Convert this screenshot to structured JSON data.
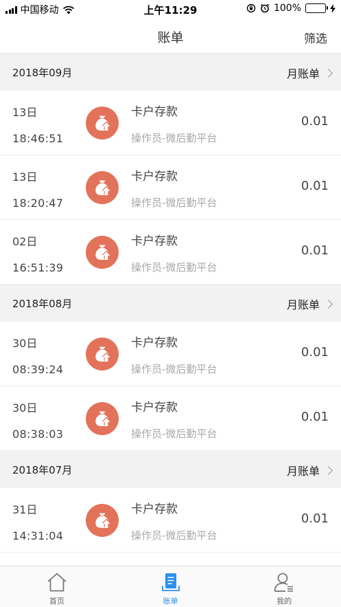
{
  "status_bar": {
    "carrier": "中国移动",
    "time": "上午11:29",
    "battery": "100%"
  },
  "nav": {
    "title": "账单",
    "action": "筛选"
  },
  "sections": [
    {
      "month": "2018年09月",
      "link": "月账单",
      "items": [
        {
          "day": "13日",
          "time": "18:46:51",
          "title": "卡户存款",
          "subtitle": "操作员-微后勤平台",
          "amount": "0.01"
        },
        {
          "day": "13日",
          "time": "18:20:47",
          "title": "卡户存款",
          "subtitle": "操作员-微后勤平台",
          "amount": "0.01"
        },
        {
          "day": "02日",
          "time": "16:51:39",
          "title": "卡户存款",
          "subtitle": "操作员-微后勤平台",
          "amount": "0.01"
        }
      ]
    },
    {
      "month": "2018年08月",
      "link": "月账单",
      "items": [
        {
          "day": "30日",
          "time": "08:39:24",
          "title": "卡户存款",
          "subtitle": "操作员-微后勤平台",
          "amount": "0.01"
        },
        {
          "day": "30日",
          "time": "08:38:03",
          "title": "卡户存款",
          "subtitle": "操作员-微后勤平台",
          "amount": "0.01"
        }
      ]
    },
    {
      "month": "2018年07月",
      "link": "月账单",
      "items": [
        {
          "day": "31日",
          "time": "14:31:04",
          "title": "卡户存款",
          "subtitle": "操作员-微后勤平台",
          "amount": "0.01"
        }
      ]
    }
  ],
  "tabs": [
    {
      "label": "首页",
      "icon": "home-icon",
      "active": false
    },
    {
      "label": "账单",
      "icon": "bill-icon",
      "active": true
    },
    {
      "label": "我的",
      "icon": "profile-icon",
      "active": false
    }
  ],
  "colors": {
    "accent": "#2b8ff0",
    "icon_bg": "#e2735a",
    "section_bg": "#f2f2f2",
    "battery": "#4cd964"
  }
}
